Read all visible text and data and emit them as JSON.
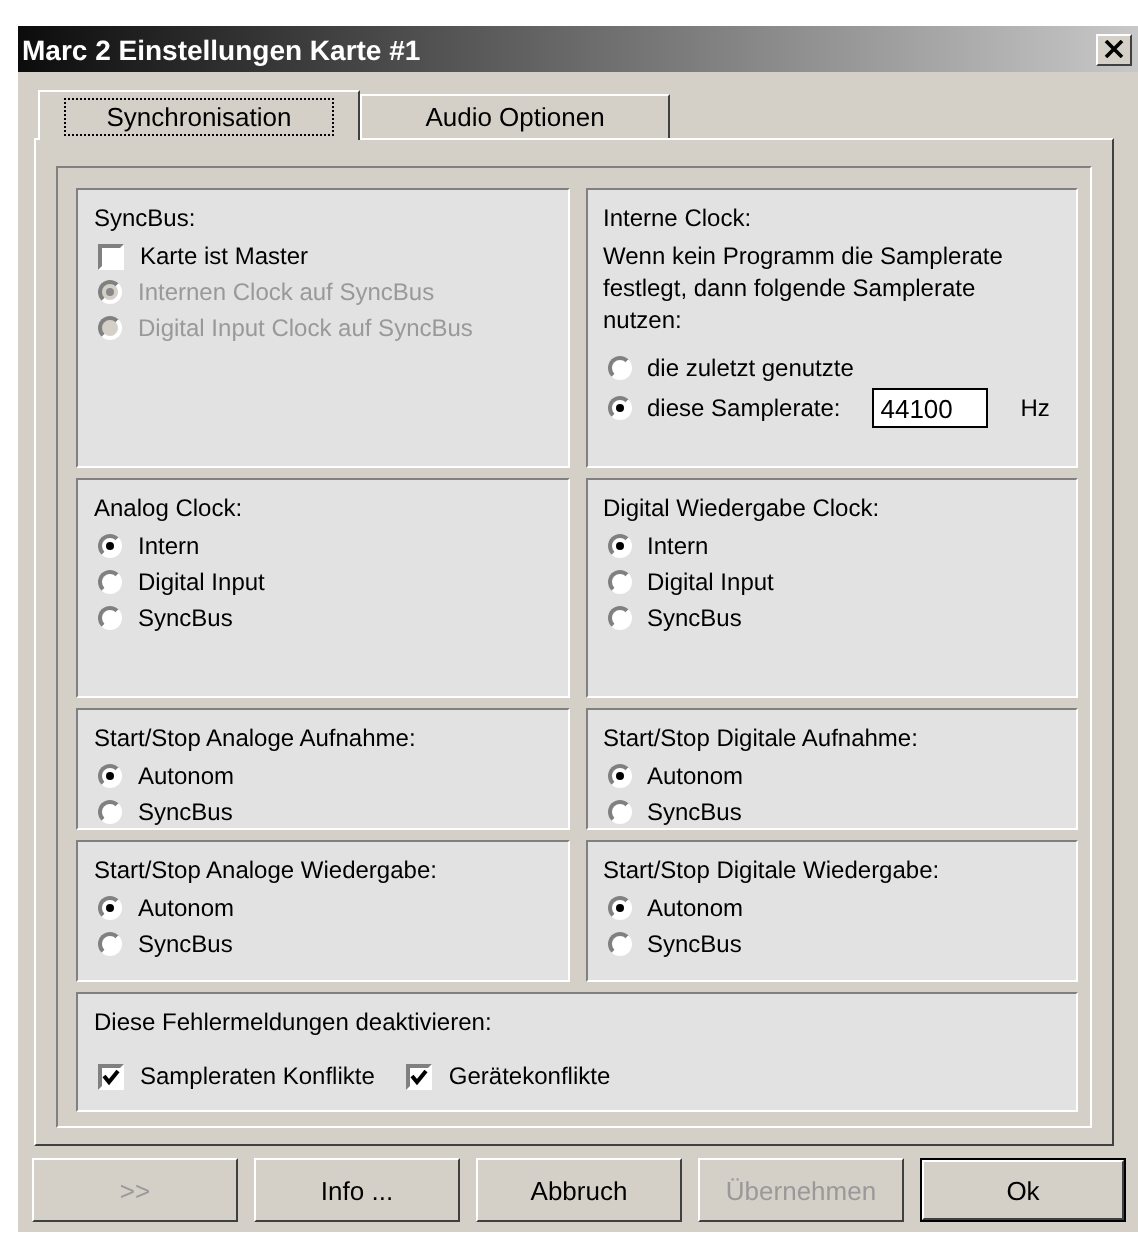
{
  "window": {
    "title": "Marc 2 Einstellungen Karte #1"
  },
  "tabs": [
    {
      "label": "Synchronisation",
      "selected": true
    },
    {
      "label": "Audio Optionen",
      "selected": false
    }
  ],
  "groups": [
    {
      "title": "SyncBus:",
      "items": [
        {
          "kind": "checkbox",
          "label": "Karte ist Master",
          "checked": false,
          "disabled": false
        },
        {
          "kind": "radio",
          "label": "Internen Clock auf SyncBus",
          "selected": true,
          "disabled": true
        },
        {
          "kind": "radio",
          "label": "Digital Input Clock auf SyncBus",
          "selected": false,
          "disabled": true
        }
      ]
    },
    {
      "title": "Interne Clock:",
      "description": "Wenn kein Programm die Samplerate festlegt, dann folgende Samplerate nutzen:",
      "items": [
        {
          "kind": "radio",
          "label": "die zuletzt genutzte",
          "selected": false,
          "disabled": false
        },
        {
          "kind": "radio-field",
          "label": "diese Samplerate:",
          "selected": true,
          "disabled": false,
          "value": "44100",
          "unit": "Hz"
        }
      ]
    },
    {
      "title": "Analog Clock:",
      "items": [
        {
          "kind": "radio",
          "label": "Intern",
          "selected": true,
          "disabled": false
        },
        {
          "kind": "radio",
          "label": "Digital Input",
          "selected": false,
          "disabled": false
        },
        {
          "kind": "radio",
          "label": "SyncBus",
          "selected": false,
          "disabled": false
        }
      ]
    },
    {
      "title": "Digital Wiedergabe Clock:",
      "items": [
        {
          "kind": "radio",
          "label": "Intern",
          "selected": true,
          "disabled": false
        },
        {
          "kind": "radio",
          "label": "Digital Input",
          "selected": false,
          "disabled": false
        },
        {
          "kind": "radio",
          "label": "SyncBus",
          "selected": false,
          "disabled": false
        }
      ]
    },
    {
      "title": "Start/Stop Analoge Aufnahme:",
      "items": [
        {
          "kind": "radio",
          "label": "Autonom",
          "selected": true,
          "disabled": false
        },
        {
          "kind": "radio",
          "label": "SyncBus",
          "selected": false,
          "disabled": false
        }
      ]
    },
    {
      "title": "Start/Stop Digitale Aufnahme:",
      "items": [
        {
          "kind": "radio",
          "label": "Autonom",
          "selected": true,
          "disabled": false
        },
        {
          "kind": "radio",
          "label": "SyncBus",
          "selected": false,
          "disabled": false
        }
      ]
    },
    {
      "title": "Start/Stop Analoge Wiedergabe:",
      "items": [
        {
          "kind": "radio",
          "label": "Autonom",
          "selected": true,
          "disabled": false
        },
        {
          "kind": "radio",
          "label": "SyncBus",
          "selected": false,
          "disabled": false
        }
      ]
    },
    {
      "title": "Start/Stop Digitale Wiedergabe:",
      "items": [
        {
          "kind": "radio",
          "label": "Autonom",
          "selected": true,
          "disabled": false
        },
        {
          "kind": "radio",
          "label": "SyncBus",
          "selected": false,
          "disabled": false
        }
      ]
    }
  ],
  "errors": {
    "title": "Diese Fehlermeldungen deaktivieren:",
    "items": [
      {
        "kind": "checkbox",
        "label": "Sampleraten Konflikte",
        "checked": true,
        "disabled": false
      },
      {
        "kind": "checkbox",
        "label": "Gerätekonflikte",
        "checked": true,
        "disabled": false
      }
    ]
  },
  "buttons": [
    {
      "label": ">>",
      "disabled": true,
      "default": false
    },
    {
      "label": "Info ...",
      "disabled": false,
      "default": false
    },
    {
      "label": "Abbruch",
      "disabled": false,
      "default": false
    },
    {
      "label": "Übernehmen",
      "disabled": true,
      "default": false
    },
    {
      "label": "Ok",
      "disabled": false,
      "default": true
    }
  ]
}
